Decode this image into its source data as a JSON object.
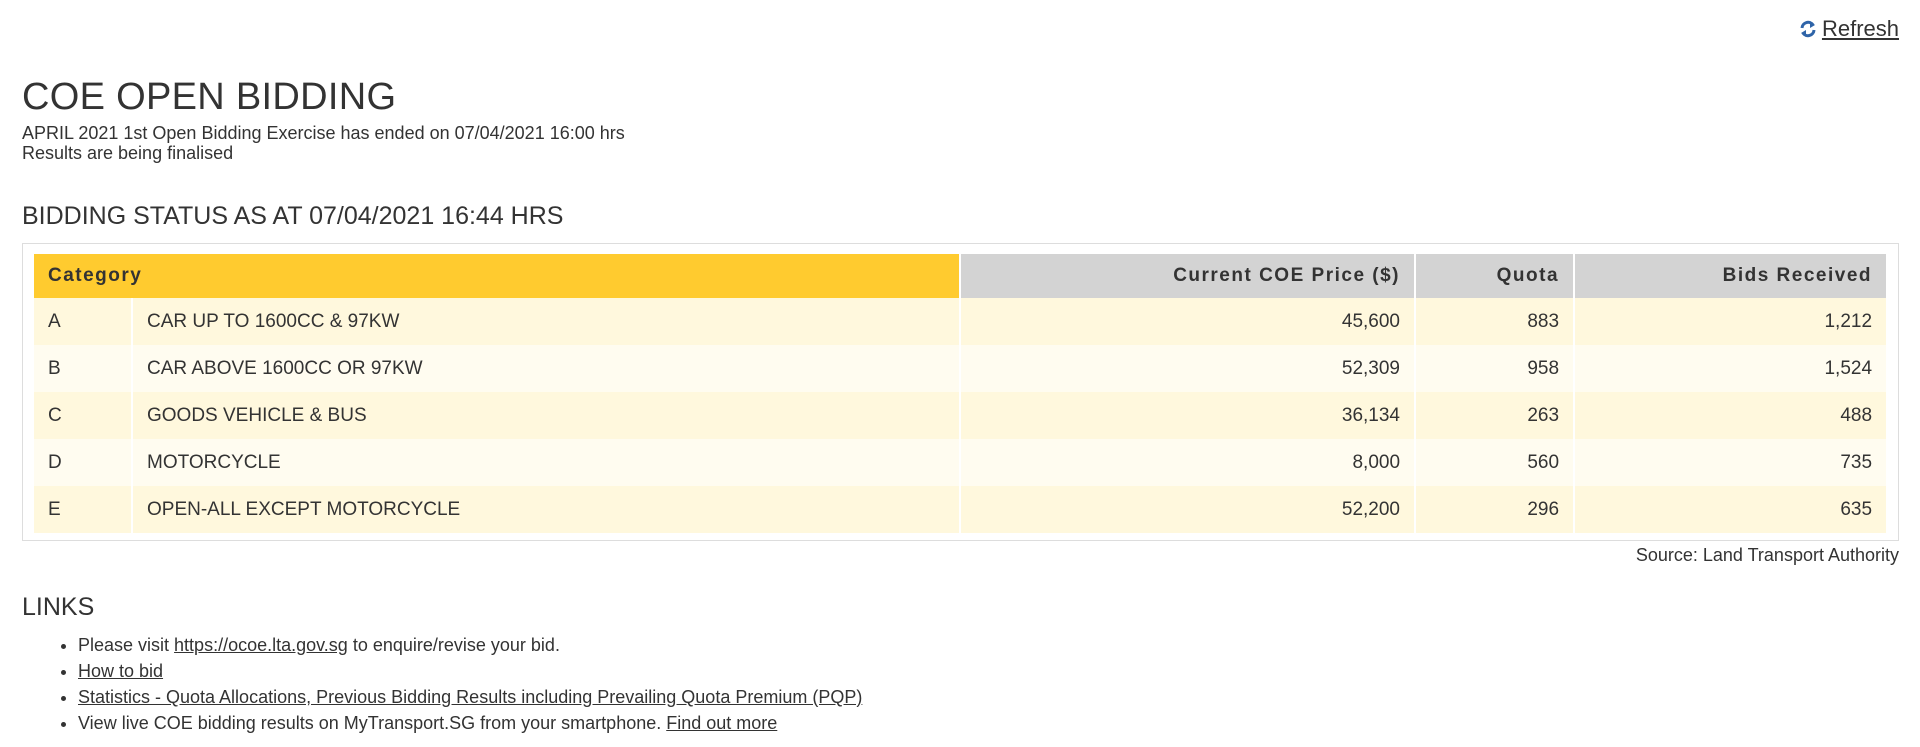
{
  "header": {
    "refresh_label": "Refresh",
    "refresh_icon": "refresh-icon",
    "refresh_icon_color": "#2f64a8"
  },
  "page": {
    "title": "COE OPEN BIDDING",
    "status_line_1": "APRIL 2021 1st Open Bidding Exercise has ended on 07/04/2021 16:00 hrs",
    "status_line_2": "Results are being finalised"
  },
  "bidding": {
    "heading": "BIDDING STATUS AS AT 07/04/2021 16:44 HRS",
    "columns": {
      "category": "Category",
      "price": "Current COE Price ($)",
      "quota": "Quota",
      "bids": "Bids Received"
    },
    "rows": [
      {
        "code": "A",
        "name": "CAR UP TO 1600CC & 97KW",
        "price": "45,600",
        "quota": "883",
        "bids": "1,212"
      },
      {
        "code": "B",
        "name": "CAR ABOVE 1600CC OR 97KW",
        "price": "52,309",
        "quota": "958",
        "bids": "1,524"
      },
      {
        "code": "C",
        "name": "GOODS VEHICLE & BUS",
        "price": "36,134",
        "quota": "263",
        "bids": "488"
      },
      {
        "code": "D",
        "name": "MOTORCYCLE",
        "price": "8,000",
        "quota": "560",
        "bids": "735"
      },
      {
        "code": "E",
        "name": "OPEN-ALL EXCEPT MOTORCYCLE",
        "price": "52,200",
        "quota": "296",
        "bids": "635"
      }
    ],
    "source": "Source: Land Transport Authority",
    "colors": {
      "category_header": "#ffcb2f",
      "numeric_header": "#d3d3d3",
      "row_odd": "#fff8dd",
      "row_even": "#fffcf0"
    }
  },
  "links": {
    "heading": "LINKS",
    "item1_prefix": "Please visit ",
    "item1_link": "https://ocoe.lta.gov.sg",
    "item1_suffix": " to enquire/revise your bid.",
    "item2_link": "How to bid",
    "item3_link": "Statistics - Quota Allocations, Previous Bidding Results including Prevailing Quota Premium (PQP)",
    "item4_prefix": "View live COE bidding results on MyTransport.SG from your smartphone. ",
    "item4_link": "Find out more"
  }
}
